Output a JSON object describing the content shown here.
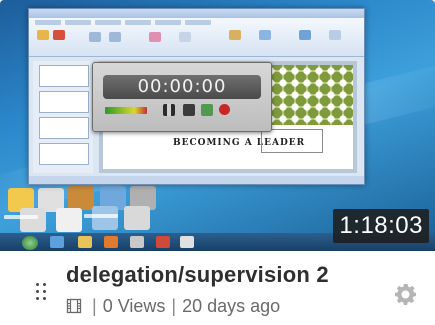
{
  "video": {
    "duration": "1:18:03",
    "title": "delegation/supervision 2",
    "views": "0 Views",
    "age": "20 days ago",
    "separator": "|",
    "type_icon": "video-file-icon"
  },
  "preview": {
    "timer": "00:00:00",
    "slide_title": "BECOMING A LEADER"
  },
  "icons": {
    "drag": "drag-handle-icon",
    "settings": "gear-icon"
  },
  "colors": {
    "title": "#2f2f2f",
    "meta": "#6a6a6a",
    "badge_bg": "#1e1e1e",
    "desktop": "#2b86c9"
  }
}
